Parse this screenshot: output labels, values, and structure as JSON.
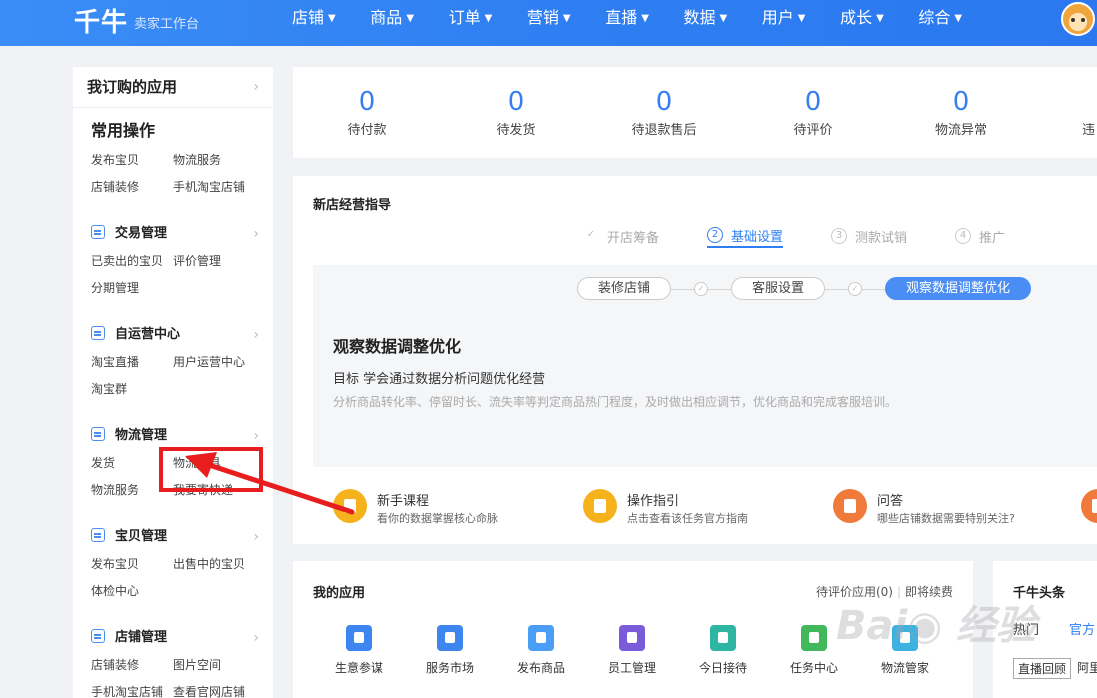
{
  "header": {
    "logo": "千牛",
    "subtitle": "卖家工作台",
    "nav": [
      {
        "label": "店铺"
      },
      {
        "label": "商品"
      },
      {
        "label": "订单"
      },
      {
        "label": "营销"
      },
      {
        "label": "直播"
      },
      {
        "label": "数据"
      },
      {
        "label": "用户"
      },
      {
        "label": "成长"
      },
      {
        "label": "综合"
      }
    ]
  },
  "sidebar": {
    "title": "我订购的应用",
    "common": {
      "title": "常用操作",
      "rows": [
        [
          "发布宝贝",
          "物流服务"
        ],
        [
          "店铺装修",
          "手机淘宝店铺"
        ]
      ]
    },
    "sections": [
      {
        "title": "交易管理",
        "icon": "calendar-icon",
        "rows": [
          [
            "已卖出的宝贝",
            "评价管理"
          ],
          [
            "分期管理"
          ]
        ]
      },
      {
        "title": "自运营中心",
        "icon": "chat-icon",
        "rows": [
          [
            "淘宝直播",
            "用户运营中心"
          ],
          [
            "淘宝群"
          ]
        ]
      },
      {
        "title": "物流管理",
        "icon": "truck-icon",
        "rows": [
          [
            "发货",
            "物流工具"
          ],
          [
            "物流服务",
            "我要寄快递"
          ]
        ]
      },
      {
        "title": "宝贝管理",
        "icon": "box-icon",
        "rows": [
          [
            "发布宝贝",
            "出售中的宝贝"
          ],
          [
            "体检中心"
          ]
        ]
      },
      {
        "title": "店铺管理",
        "icon": "shop-icon",
        "rows": [
          [
            "店铺装修",
            "图片空间"
          ],
          [
            "手机淘宝店铺",
            "查看官网店铺"
          ]
        ]
      }
    ]
  },
  "stats": [
    {
      "value": "0",
      "label": "待付款"
    },
    {
      "value": "0",
      "label": "待发货"
    },
    {
      "value": "0",
      "label": "待退款售后"
    },
    {
      "value": "0",
      "label": "待评价"
    },
    {
      "value": "0",
      "label": "物流异常"
    },
    {
      "value": "",
      "label": "违"
    }
  ],
  "guide": {
    "title": "新店经营指导",
    "steps": [
      {
        "marker": "✓",
        "label": "开店筹备"
      },
      {
        "marker": "2",
        "label": "基础设置"
      },
      {
        "marker": "3",
        "label": "测款试销"
      },
      {
        "marker": "4",
        "label": "推广"
      }
    ],
    "subtabs": [
      "装修店铺",
      "客服设置",
      "观察数据调整优化"
    ],
    "heading": "观察数据调整优化",
    "goal": "目标 学会通过数据分析问题优化经营",
    "desc": "分析商品转化率、停留时长、流失率等判定商品热门程度，及时做出相应调节，优化商品和完成客服培训。",
    "help": [
      {
        "title": "新手课程",
        "sub": "看你的数据掌握核心命脉",
        "color": "#f5b21c"
      },
      {
        "title": "操作指引",
        "sub": "点击查看该任务官方指南",
        "color": "#f5b21c"
      },
      {
        "title": "问答",
        "sub": "哪些店铺数据需要特别关注?",
        "color": "#f07a3a"
      }
    ]
  },
  "apps": {
    "title": "我的应用",
    "link1": "待评价应用(0)",
    "link2": "即将续费",
    "items": [
      {
        "label": "生意参谋",
        "color": "#3d86f0"
      },
      {
        "label": "服务市场",
        "color": "#3d86f0"
      },
      {
        "label": "发布商品",
        "color": "#4a9ef5"
      },
      {
        "label": "员工管理",
        "color": "#7b5bd9"
      },
      {
        "label": "今日接待",
        "color": "#2fb6a3"
      },
      {
        "label": "任务中心",
        "color": "#41b95a"
      },
      {
        "label": "物流管家",
        "color": "#3db2e0"
      }
    ]
  },
  "news": {
    "title": "千牛头条",
    "tab1": "热门",
    "tab2": "官方",
    "badge": "直播回顾",
    "badge2": "阿里"
  }
}
